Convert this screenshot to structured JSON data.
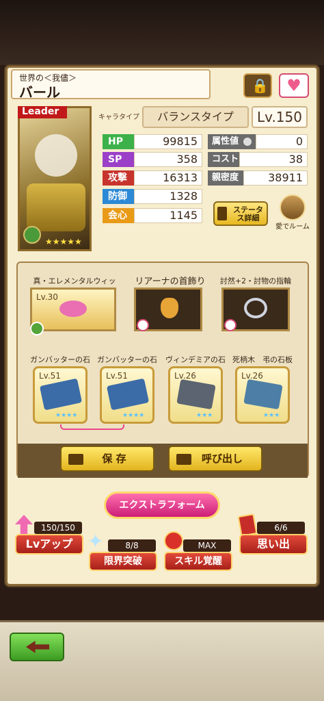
{
  "title": {
    "subtitle": "世界の＜我儘＞",
    "name": "バール"
  },
  "leader_tag": "Leader",
  "stars": "★★★★★",
  "chara_type_label": "キャラタイプ",
  "chara_type": "バランスタイプ",
  "level": "Lv.150",
  "stats": [
    {
      "label": "HP",
      "value": "99815",
      "color": "#3cb14a"
    },
    {
      "label": "SP",
      "value": "358",
      "color": "#9b3fc8"
    },
    {
      "label": "攻撃",
      "value": "16313",
      "color": "#c7332d"
    },
    {
      "label": "防御",
      "value": "1328",
      "color": "#2c89d6"
    },
    {
      "label": "会心",
      "value": "1145",
      "color": "#e99a17"
    }
  ],
  "right_stats": [
    {
      "label": "属性値",
      "value": "0"
    },
    {
      "label": "コスト",
      "value": "38"
    },
    {
      "label": "親密度",
      "value": "38911"
    }
  ],
  "status_detail": "ステータス詳細",
  "room": "愛でルーム",
  "equipment": [
    {
      "name": "真・エレメンタルウィッシュ",
      "level": "Lv.30"
    },
    {
      "name": "リアーナの首飾り"
    },
    {
      "name": "討然+2・討物の指輪"
    }
  ],
  "slabs": [
    {
      "name": "ガンバッターの石板",
      "level": "Lv.51",
      "stars": "★★★★"
    },
    {
      "name": "ガンバッターの石板",
      "level": "Lv.51",
      "stars": "★★★★"
    },
    {
      "name": "ヴィンデミアの石板",
      "level": "Lv.26",
      "stars": "★★★"
    },
    {
      "name": "死柄木　弔の石板",
      "level": "Lv.26",
      "stars": "★★★"
    }
  ],
  "save": "保 存",
  "call": "呼び出し",
  "extra": "エクストラフォーム",
  "bottom_buttons": [
    {
      "label": "Lvアップ",
      "counter": "150/150"
    },
    {
      "label": "限界突破",
      "counter": "8/8"
    },
    {
      "label": "スキル覚醒",
      "counter": "MAX"
    },
    {
      "label": "思い出",
      "counter": "6/6"
    }
  ]
}
